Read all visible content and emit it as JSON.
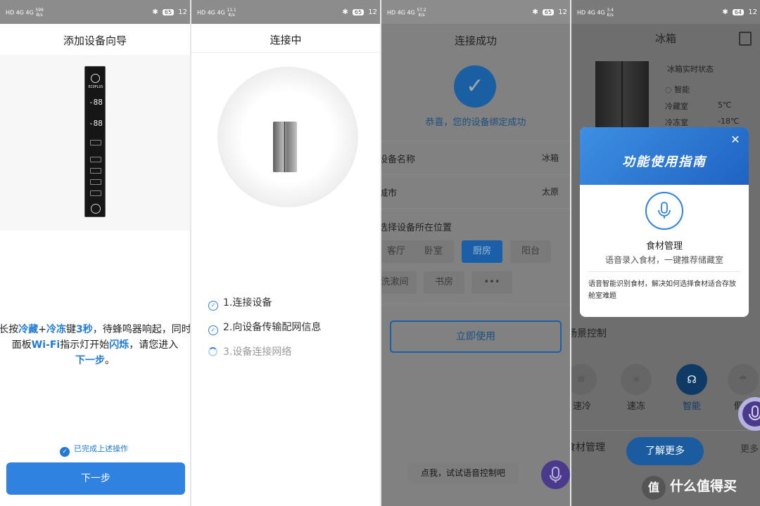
{
  "screens": [
    {
      "status": {
        "network": "HD 4G 4G",
        "speed_value": "599",
        "speed_unit": "B/s",
        "battery": "65",
        "time": "12"
      },
      "title": "添加设备向导",
      "panel": {
        "brand": "ECOPLUS",
        "display_top": "-88",
        "display_bottom": "-88"
      },
      "instruction": {
        "t1": "长按",
        "b1": "冷藏",
        "t2": "+",
        "b2": "冷冻",
        "t3": "键",
        "b3": "3秒",
        "t4": "，待蜂鸣器响起，同时面板",
        "b4": "Wi-Fi",
        "t5": "指示灯开始",
        "b5": "闪烁",
        "t6": "，请您进入",
        "b6": "下一步",
        "t7": "。"
      },
      "checkbox_label": "已完成上述操作",
      "next_button": "下一步"
    },
    {
      "status": {
        "network": "HD 4G 4G",
        "speed_value": "11.1",
        "speed_unit": "K/s",
        "battery": "65",
        "time": "12"
      },
      "title": "连接中",
      "steps": [
        "1.连接设备",
        "2.向设备传输配网信息",
        "3.设备连接网络"
      ]
    },
    {
      "status": {
        "network": "HD 4G 4G",
        "speed_value": "57.2",
        "speed_unit": "K/s",
        "battery": "65",
        "time": "12"
      },
      "title": "连接成功",
      "success_text": "恭喜，您的设备绑定成功",
      "rows": [
        {
          "label": "设备名称",
          "value": "冰箱"
        },
        {
          "label": "城市",
          "value": "太原"
        }
      ],
      "location_label": "选择设备所在位置",
      "chips": [
        "客厅",
        "卧室",
        "厨房",
        "阳台",
        "洗漱间",
        "书房",
        "•••"
      ],
      "selected_chip": "厨房",
      "use_button": "立即使用",
      "voice_tip": "点我，试试语音控制吧"
    },
    {
      "status": {
        "network": "HD 4G 4G",
        "speed_value": "3.4",
        "speed_unit": "K/s",
        "battery": "64",
        "time": "12"
      },
      "title": "冰箱",
      "realtime_label": "冰箱实时状态",
      "mode": "智能",
      "temps": [
        {
          "label": "冷藏室",
          "value": "5℃"
        },
        {
          "label": "冷冻室",
          "value": "-18℃"
        }
      ],
      "scene_label": "场景控制",
      "controls": [
        "速冷",
        "速冻",
        "智能",
        "假日"
      ],
      "active_control": "智能",
      "food_label": "食材管理",
      "more_label": "更多",
      "guide": {
        "title": "功能使用指南",
        "heading": "食材管理",
        "subtitle": "语音录入食材，一键推荐储藏室",
        "description": "语音智能识别食材，解决如何选择食材适合存放舱室难题"
      },
      "learn_button": "了解更多",
      "watermark": "什么值得买",
      "watermark_logo": "值"
    }
  ],
  "colors": {
    "accent": "#2f82e0",
    "accent_dark": "#1b5ca0",
    "overlay": "#818181"
  }
}
